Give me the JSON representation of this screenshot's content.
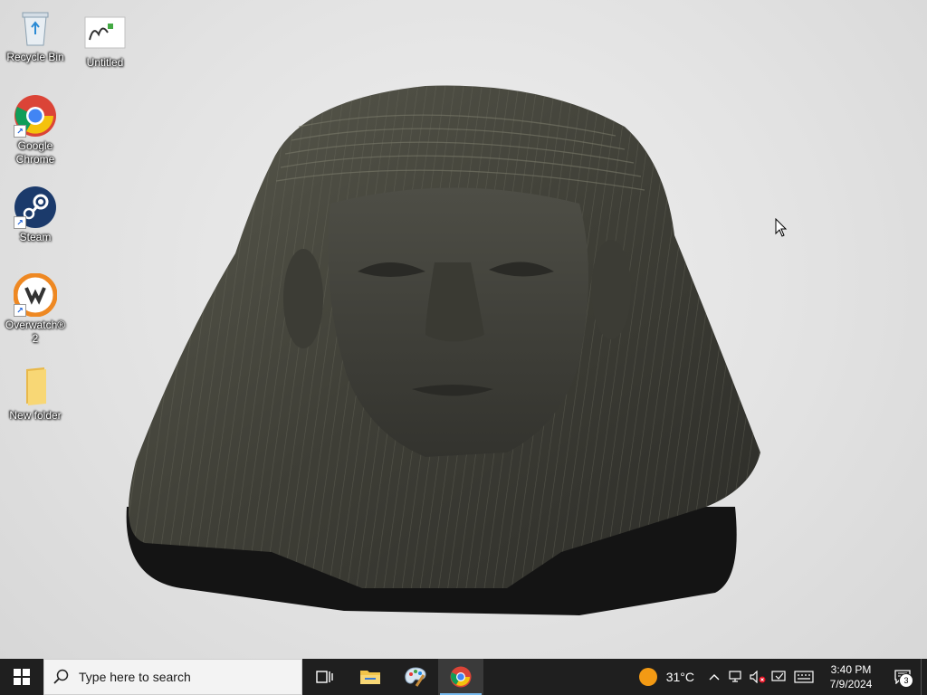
{
  "desktop": {
    "icons": [
      {
        "label": "Recycle Bin",
        "icon": "recycle-bin-icon"
      },
      {
        "label": "Untitled",
        "icon": "paint-image-thumbnail-icon"
      },
      {
        "label": "Google Chrome",
        "icon": "chrome-icon"
      },
      {
        "label": "Steam",
        "icon": "steam-icon"
      },
      {
        "label": "Overwatch® 2",
        "icon": "overwatch-icon"
      },
      {
        "label": "New folder",
        "icon": "folder-icon"
      }
    ]
  },
  "taskbar": {
    "search_placeholder": "Type here to search",
    "pinned": [
      {
        "name": "task-view",
        "icon": "task-view-icon"
      },
      {
        "name": "file-explorer",
        "icon": "folder-icon"
      },
      {
        "name": "paint",
        "icon": "paint-palette-icon"
      },
      {
        "name": "chrome",
        "icon": "chrome-icon",
        "active": true
      }
    ],
    "weather": {
      "temp": "31°C",
      "icon": "sun-icon",
      "color": "#f39a14"
    },
    "tray_icons": [
      "chevron-up-icon",
      "network-icon",
      "volume-muted-icon",
      "security-icon",
      "keyboard-icon"
    ],
    "clock": {
      "time": "3:40 PM",
      "date": "7/9/2024"
    },
    "notifications": {
      "count": "3"
    }
  },
  "colors": {
    "taskbar": "#1f1f1f",
    "accent": "#76b9ed"
  }
}
